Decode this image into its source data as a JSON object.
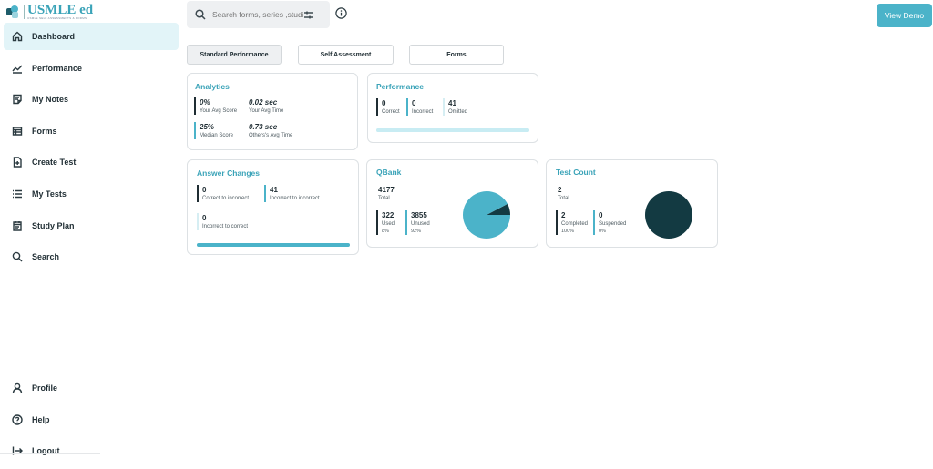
{
  "brand": {
    "name": "USMLE ed",
    "tagline": "USMLE SELF ASSESSMENTS & FORMS"
  },
  "nav": [
    {
      "label": "Dashboard",
      "icon": "home-icon",
      "active": true
    },
    {
      "label": "Performance",
      "icon": "chart-line-icon"
    },
    {
      "label": "My Notes",
      "icon": "notes-icon"
    },
    {
      "label": "Forms",
      "icon": "forms-icon"
    },
    {
      "label": "Create Test",
      "icon": "create-test-icon"
    },
    {
      "label": "My Tests",
      "icon": "list-icon"
    },
    {
      "label": "Study Plan",
      "icon": "calendar-icon"
    },
    {
      "label": "Search",
      "icon": "search-icon"
    }
  ],
  "nav_bottom": [
    {
      "label": "Profile",
      "icon": "user-icon"
    },
    {
      "label": "Help",
      "icon": "help-icon"
    },
    {
      "label": "Logout",
      "icon": "logout-icon"
    }
  ],
  "search": {
    "placeholder": "Search forms, series ,studies"
  },
  "header": {
    "demo_button": "View Demo"
  },
  "tabs": [
    "Standard Performance",
    "Self Assessment",
    "Forms"
  ],
  "analytics": {
    "title": "Analytics",
    "your_avg_score": {
      "value": "0%",
      "label": "Your Avg Score"
    },
    "your_avg_time": {
      "value": "0.02 sec",
      "label": "Your Avg Time"
    },
    "median_score": {
      "value": "25%",
      "label": "Median Score"
    },
    "others_avg_time": {
      "value": "0.73 sec",
      "label": "Others's Avg Time"
    }
  },
  "performance": {
    "title": "Performance",
    "correct": {
      "value": "0",
      "label": "Correct"
    },
    "incorrect": {
      "value": "0",
      "label": "Incorrect"
    },
    "omitted": {
      "value": "41",
      "label": "Omitted"
    },
    "omitted_fraction": 1.0
  },
  "answer_changes": {
    "title": "Answer Changes",
    "correct_to_incorrect": {
      "value": "0",
      "label": "Correct to incorrect"
    },
    "incorrect_to_incorrect": {
      "value": "41",
      "label": "Incorrect to incorrect"
    },
    "incorrect_to_correct": {
      "value": "0",
      "label": "Incorrect to correct"
    },
    "incorrect_to_incorrect_fraction": 1.0
  },
  "qbank": {
    "title": "QBank",
    "total": {
      "value": "4177",
      "label": "Total"
    },
    "used": {
      "value": "322",
      "label": "Used",
      "pct": "8%"
    },
    "unused": {
      "value": "3855",
      "label": "Unused",
      "pct": "92%"
    }
  },
  "test_count": {
    "title": "Test Count",
    "total": {
      "value": "2",
      "label": "Total"
    },
    "completed": {
      "value": "2",
      "label": "Completed",
      "pct": "100%"
    },
    "suspended": {
      "value": "0",
      "label": "Suspended",
      "pct": "0%"
    }
  },
  "colors": {
    "accent": "#4bb3c9",
    "dark": "#133a42",
    "pale": "#d6eef3"
  }
}
